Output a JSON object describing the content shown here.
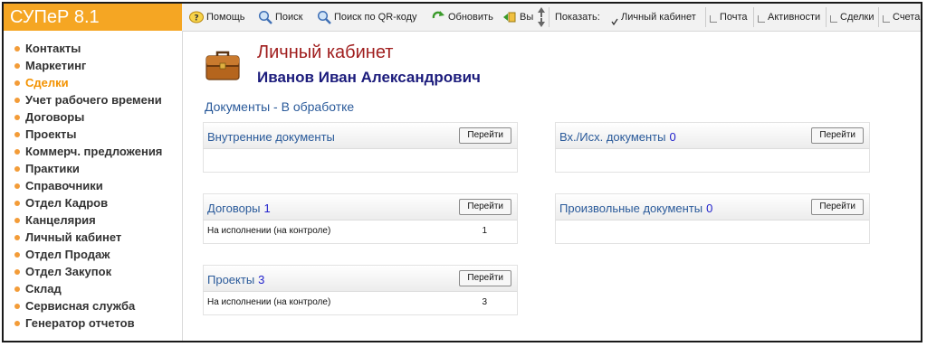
{
  "app": {
    "title": "СУПеР 8.1",
    "accent": "#f5a623"
  },
  "toolbar": {
    "help": "Помощь",
    "search": "Поиск",
    "qr_search": "Поиск по QR-коду",
    "refresh": "Обновить",
    "exit": "Вы",
    "show_label": "Показать:",
    "toggles": [
      {
        "label": "Личный кабинет",
        "checked": true
      },
      {
        "label": "Почта",
        "checked": false
      },
      {
        "label": "Активности",
        "checked": false
      },
      {
        "label": "Сделки",
        "checked": false
      },
      {
        "label": "Счета",
        "checked": false
      }
    ]
  },
  "sidebar": {
    "items": [
      {
        "label": "Контакты"
      },
      {
        "label": "Маркетинг"
      },
      {
        "label": "Сделки",
        "active": true
      },
      {
        "label": "Учет рабочего времени"
      },
      {
        "label": "Договоры"
      },
      {
        "label": "Проекты"
      },
      {
        "label": "Коммерч. предложения"
      },
      {
        "label": "Практики"
      },
      {
        "label": "Справочники"
      },
      {
        "label": "Отдел Кадров"
      },
      {
        "label": "Канцелярия"
      },
      {
        "label": "Личный кабинет"
      },
      {
        "label": "Отдел Продаж"
      },
      {
        "label": "Отдел Закупок"
      },
      {
        "label": "Склад"
      },
      {
        "label": "Сервисная служба"
      },
      {
        "label": "Генератор отчетов"
      }
    ]
  },
  "main": {
    "title": "Личный кабинет",
    "user_name": "Иванов Иван Александрович",
    "section_title": "Документы - В обработке",
    "panels": {
      "internal": {
        "title": "Внутренние документы",
        "count": "",
        "button": "Перейти",
        "rows": []
      },
      "inout": {
        "title": "Вх./Исх. документы",
        "count": "0",
        "button": "Перейти",
        "rows": []
      },
      "contracts": {
        "title": "Договоры",
        "count": "1",
        "button": "Перейти",
        "rows": [
          {
            "label": "На исполнении (на контроле)",
            "value": "1"
          }
        ]
      },
      "arbitrary": {
        "title": "Произвольные документы",
        "count": "0",
        "button": "Перейти",
        "rows": []
      },
      "projects": {
        "title": "Проекты",
        "count": "3",
        "button": "Перейти",
        "rows": [
          {
            "label": "На исполнении (на контроле)",
            "value": "3"
          }
        ]
      }
    }
  }
}
